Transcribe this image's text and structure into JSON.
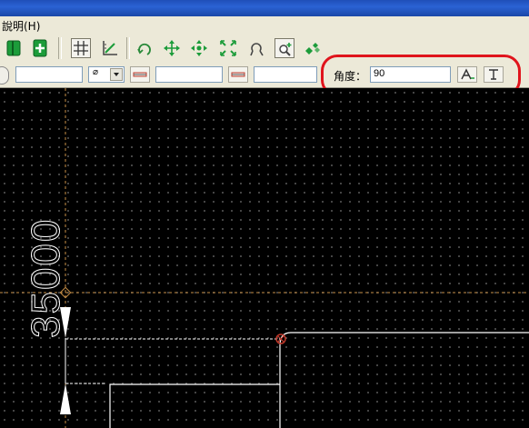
{
  "menubar": {
    "help_label": "說明(H)"
  },
  "toolbar2": {
    "diameter_symbol": "⌀",
    "angle_label": "角度：",
    "angle_value": "90"
  },
  "canvas": {
    "dimension_text": "35000"
  },
  "colors": {
    "highlight": "#e0141c",
    "guide_line": "#c89048",
    "geometry": "#ffffff",
    "point_marker": "#c0392b"
  },
  "icons": [
    "green-bar-icon",
    "add-sheet-icon",
    "grid-icon",
    "diagonal-snap-icon",
    "rotate-icon",
    "move-icon",
    "scale-icon",
    "zoom-extents-icon",
    "lasso-icon",
    "zoom-window-icon",
    "pan-icon",
    "dropdown-arrow-icon",
    "text-style-a-icon",
    "text-style-b-icon"
  ]
}
